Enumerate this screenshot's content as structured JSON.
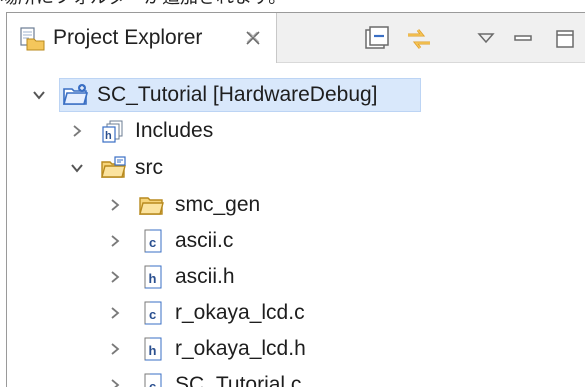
{
  "caption": "場所にフォルダーが追加されます。",
  "tab": {
    "title": "Project Explorer",
    "icon": "project-explorer-icon",
    "close_icon": "close-x-icon"
  },
  "toolbar": {
    "collapse_all_icon": "collapse-all-icon",
    "link_editor_icon": "link-with-editor-icon",
    "view_menu_icon": "view-menu-icon",
    "minimize_icon": "minimize-icon",
    "maximize_icon": "maximize-icon"
  },
  "tree": {
    "project": {
      "label": "SC_Tutorial [HardwareDebug]",
      "expanded": true,
      "icon": "project-folder-icon",
      "selected": true
    },
    "items": [
      {
        "label": "Includes",
        "expanded": false,
        "icon": "includes-icon"
      },
      {
        "label": "src",
        "expanded": true,
        "icon": "source-folder-icon"
      },
      {
        "label": "smc_gen",
        "expanded": false,
        "icon": "folder-icon"
      },
      {
        "label": "ascii.c",
        "expanded": false,
        "icon": "c-file-icon"
      },
      {
        "label": "ascii.h",
        "expanded": false,
        "icon": "h-file-icon"
      },
      {
        "label": "r_okaya_lcd.c",
        "expanded": false,
        "icon": "c-file-icon"
      },
      {
        "label": "r_okaya_lcd.h",
        "expanded": false,
        "icon": "h-file-icon"
      },
      {
        "label": "SC_Tutorial.c",
        "expanded": false,
        "icon": "c-file-icon"
      }
    ]
  },
  "colors": {
    "selection": "#d9e8fb",
    "folder": "#e8b84a",
    "project_blue": "#3a6fc4",
    "chevron": "#555555"
  }
}
